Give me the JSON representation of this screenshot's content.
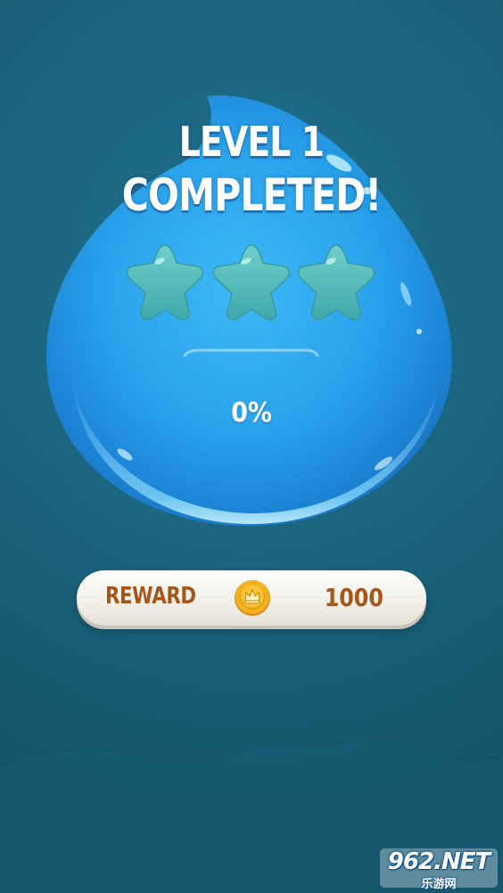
{
  "level_complete": {
    "title_line1": "LEVEL 1",
    "title_line2": "COMPLETED!",
    "stars_earned": 0,
    "stars_total": 3,
    "bucket_percent": "0%"
  },
  "reward": {
    "label": "REWARD",
    "icon": "crown-coin-icon",
    "value": "1000"
  },
  "watermark": {
    "text": "962.NET",
    "subtext": "乐游网"
  },
  "colors": {
    "background": "#1b6580",
    "drop_blue": "#2aa8f0",
    "star_empty": "#4fb7b8",
    "reward_text": "#a5561a",
    "pill": "#f3f1ea"
  }
}
